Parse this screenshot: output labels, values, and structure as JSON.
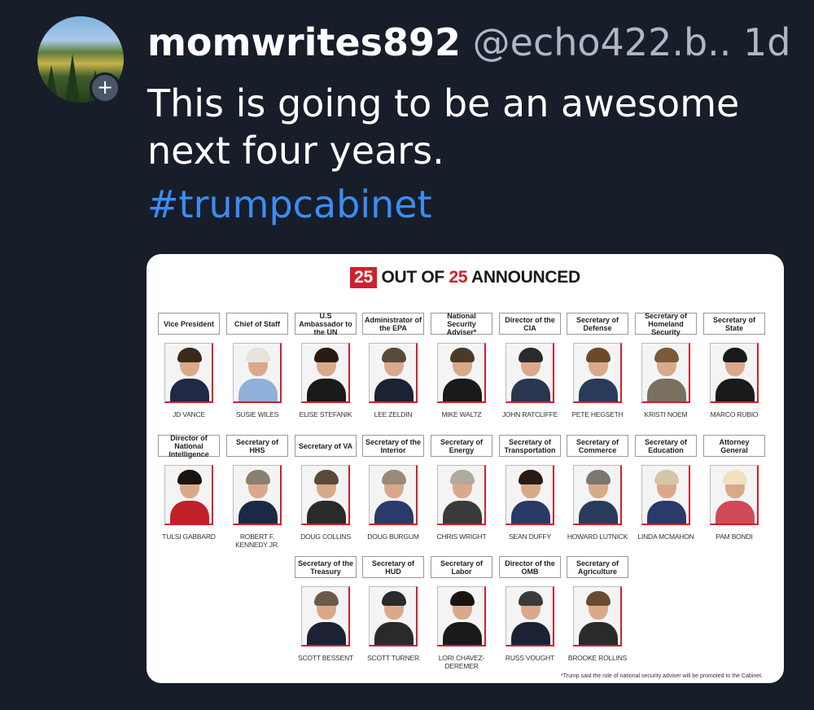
{
  "post": {
    "username": "momwrites892",
    "handle": "@echo422.b..",
    "time": "1d",
    "text": "This is going to be an awesome next four years.",
    "hashtag": "#trumpcabinet",
    "follow_symbol": "+"
  },
  "card": {
    "count": "25",
    "title_mid": "OUT OF",
    "count2": "25",
    "title_end": "ANNOUNCED",
    "footnote": "*Trump said the role of national security adviser will be promoted to the Cabinet.",
    "accent": "#d21f2c",
    "members": [
      {
        "role": "Vice President",
        "name": "JD VANCE"
      },
      {
        "role": "Chief of Staff",
        "name": "SUSIE WILES"
      },
      {
        "role": "U.S Ambassador to the UN",
        "name": "ELISE STEFANIK"
      },
      {
        "role": "Administrator of the EPA",
        "name": "LEE ZELDIN"
      },
      {
        "role": "National Security Adviser*",
        "name": "MIKE WALTZ"
      },
      {
        "role": "Director of the CIA",
        "name": "JOHN RATCLIFFE"
      },
      {
        "role": "Secretary of Defense",
        "name": "PETE HEGSETH"
      },
      {
        "role": "Secretary of Homeland Security",
        "name": "KRISTI NOEM"
      },
      {
        "role": "Secretary of State",
        "name": "MARCO RUBIO"
      },
      {
        "role": "Director of National Intelligence",
        "name": "TULSI GABBARD"
      },
      {
        "role": "Secretary of HHS",
        "name": "ROBERT F. KENNEDY JR."
      },
      {
        "role": "Secretary of VA",
        "name": "DOUG COLLINS"
      },
      {
        "role": "Secretary of the Interior",
        "name": "DOUG BURGUM"
      },
      {
        "role": "Secretary of Energy",
        "name": "CHRIS WRIGHT"
      },
      {
        "role": "Secretary of Transportation",
        "name": "SEAN DUFFY"
      },
      {
        "role": "Secretary of Commerce",
        "name": "HOWARD LUTNICK"
      },
      {
        "role": "Secretary of Education",
        "name": "LINDA MCMAHON"
      },
      {
        "role": "Attorney General",
        "name": "PAM BONDI"
      },
      {
        "role": "Secretary of the Treasury",
        "name": "SCOTT BESSENT"
      },
      {
        "role": "Secretary of HUD",
        "name": "SCOTT TURNER"
      },
      {
        "role": "Secretary of Labor",
        "name": "LORI CHAVEZ-DEREMER"
      },
      {
        "role": "Director of the OMB",
        "name": "RUSS VOUGHT"
      },
      {
        "role": "Secretary of Agriculture",
        "name": "BROOKE ROLLINS"
      }
    ]
  }
}
